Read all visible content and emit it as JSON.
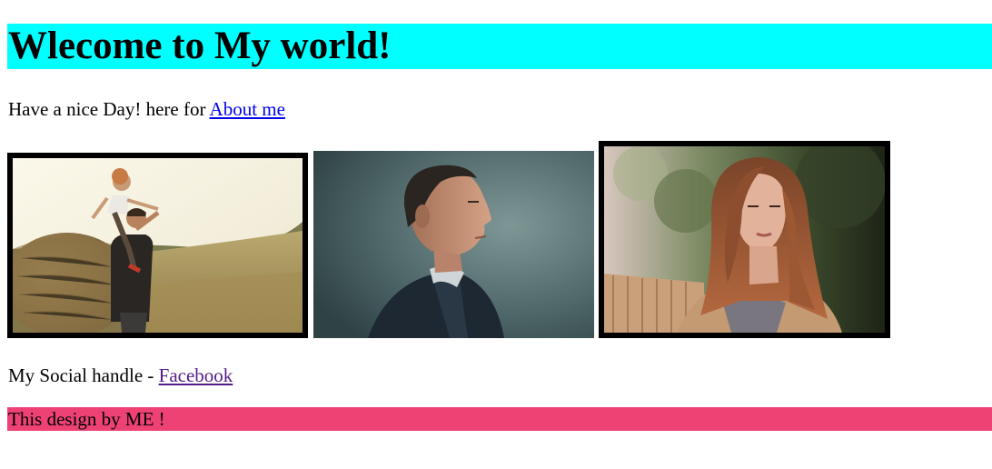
{
  "header": {
    "title": "Wlecome to My world!",
    "background": "#00ffff"
  },
  "intro": {
    "text": "Have a nice Day! here for ",
    "link_label": "About me",
    "link_color": "#0000ee"
  },
  "gallery": {
    "images": [
      {
        "name": "father-child-hay-field-photo"
      },
      {
        "name": "man-profile-portrait-photo"
      },
      {
        "name": "woman-portrait-photo"
      }
    ]
  },
  "social": {
    "text": "My Social handle - ",
    "link_label": "Facebook",
    "link_color": "#551a8b"
  },
  "footer": {
    "text": "This design by ME !",
    "background": "#ee4275"
  }
}
